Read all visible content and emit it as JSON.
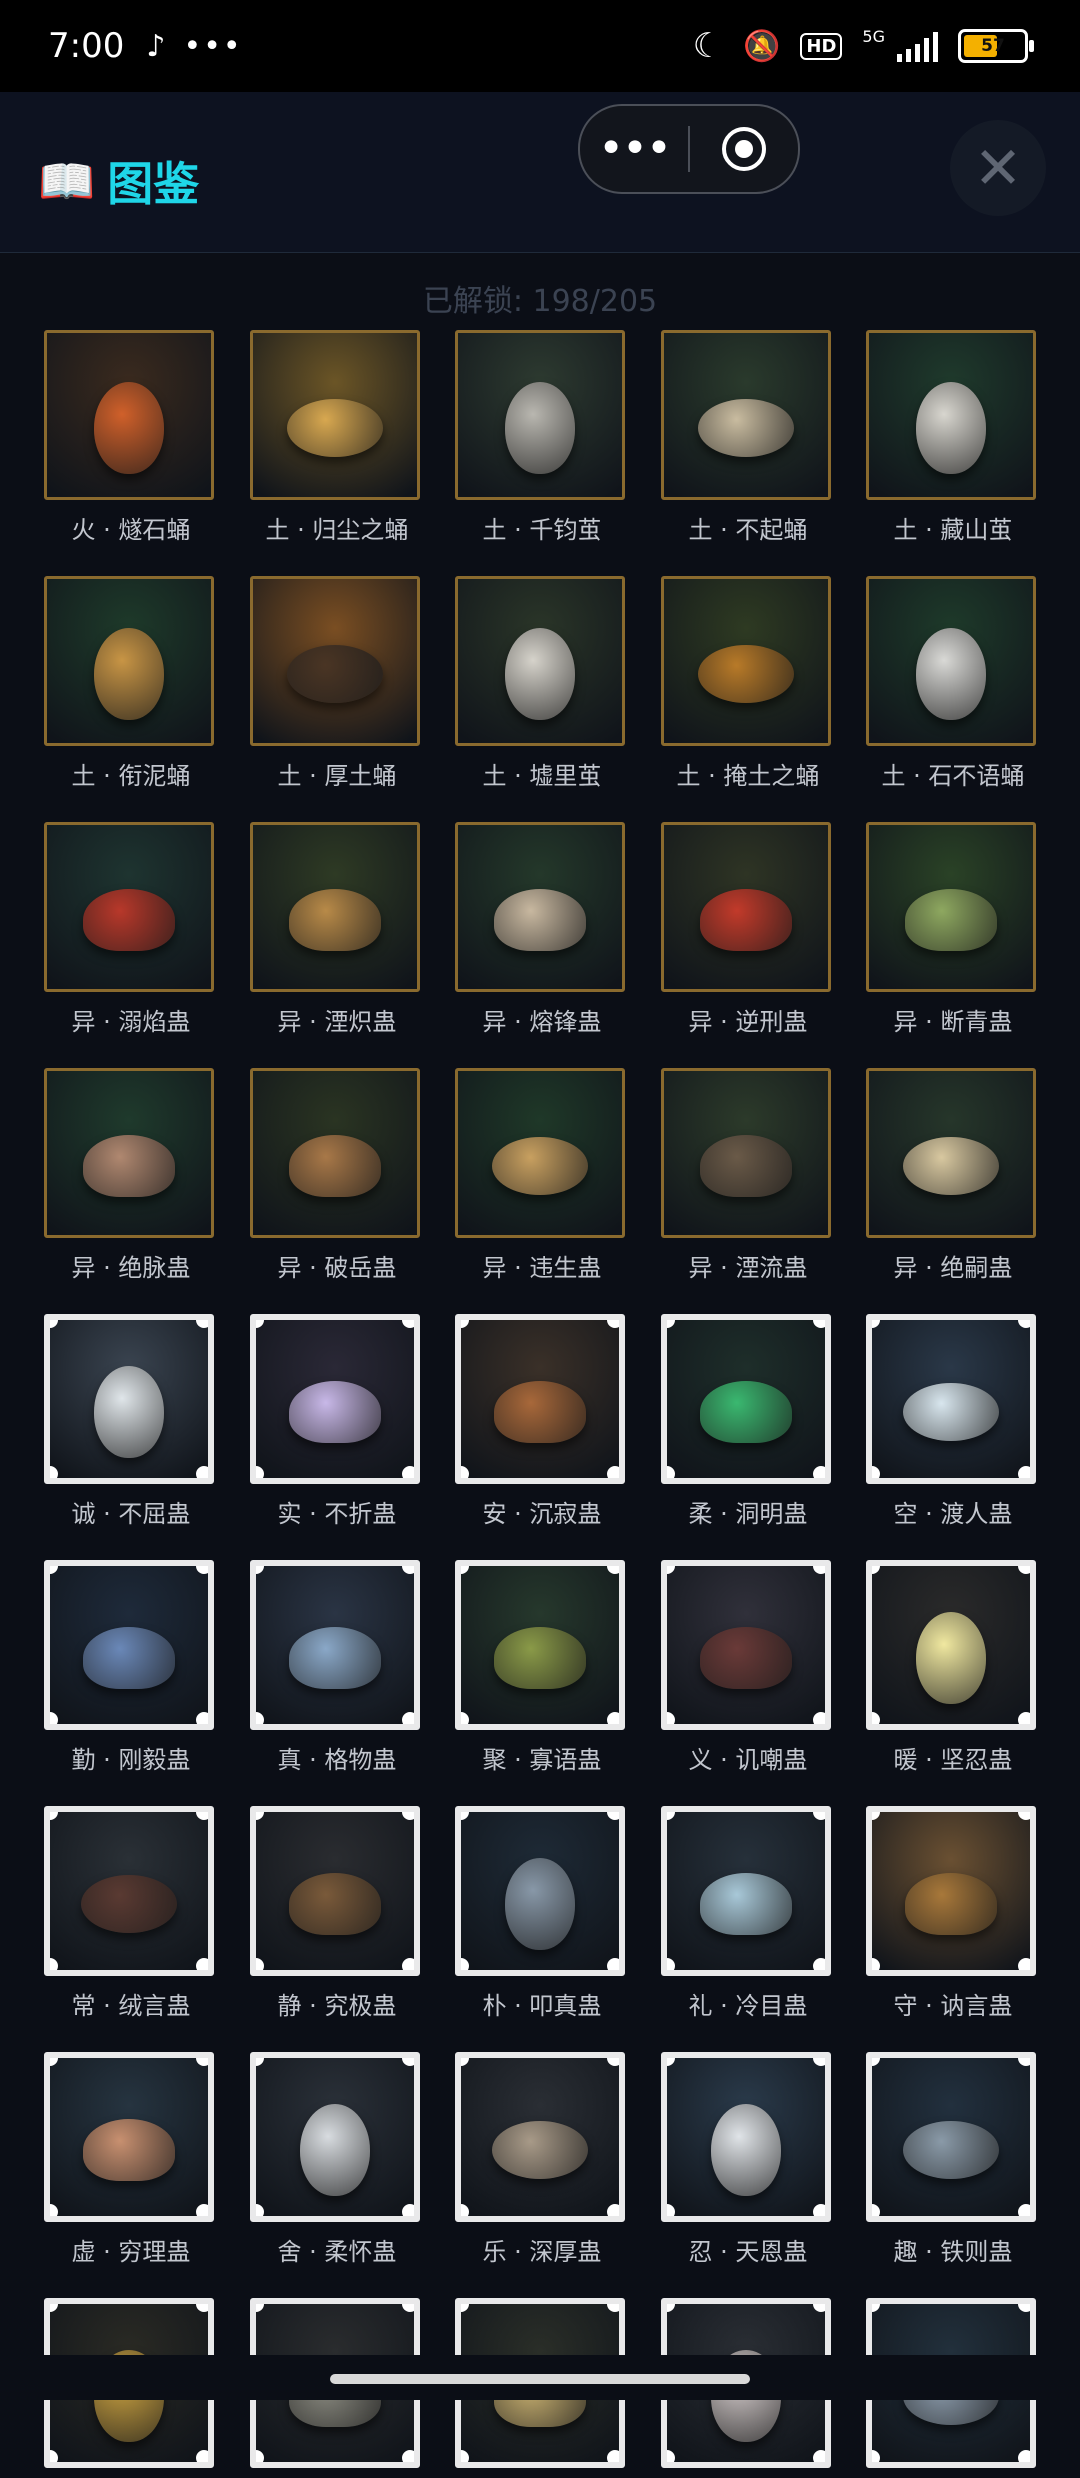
{
  "status_bar": {
    "time": "7:00",
    "network": "5G",
    "hd_badge": "HD",
    "battery": "57",
    "battery_level": 0.57,
    "icons": [
      "tiktok-icon",
      "more-dots-icon",
      "moon-icon",
      "mute-bell-icon",
      "signal-icon",
      "battery-icon"
    ]
  },
  "header": {
    "title": "图鉴",
    "book_icon": "📖",
    "capsule_more": "•••",
    "close": "✕"
  },
  "unlock_text": "已解锁: 198/205",
  "items": [
    {
      "label": "火 · 燧石蛹",
      "frame": "gold",
      "bg": "#3a2a1e",
      "c": "#d0602a",
      "s": "egg"
    },
    {
      "label": "土 · 归尘之蛹",
      "frame": "gold",
      "bg": "#6b5526",
      "c": "#d8a850",
      "s": "pupa"
    },
    {
      "label": "土 · 千钧茧",
      "frame": "gold",
      "bg": "#2d3a30",
      "c": "#b9b7b0",
      "s": "egg"
    },
    {
      "label": "土 · 不起蛹",
      "frame": "gold",
      "bg": "#2a3a2c",
      "c": "#c9bca0",
      "s": "pupa"
    },
    {
      "label": "土 · 藏山茧",
      "frame": "gold",
      "bg": "#1f3a2c",
      "c": "#d8d6cf",
      "s": "egg"
    },
    {
      "label": "土 · 衔泥蛹",
      "frame": "gold",
      "bg": "#1e3a2a",
      "c": "#c89545",
      "s": "egg"
    },
    {
      "label": "土 · 厚土蛹",
      "frame": "gold",
      "bg": "#7a4e22",
      "c": "#4a3524",
      "s": "pupa"
    },
    {
      "label": "土 · 墟里茧",
      "frame": "gold",
      "bg": "#2a3528",
      "c": "#d6d3cb",
      "s": "egg"
    },
    {
      "label": "土 · 掩土之蛹",
      "frame": "gold",
      "bg": "#2e3a22",
      "c": "#b87a28",
      "s": "pupa"
    },
    {
      "label": "土 · 石不语蛹",
      "frame": "gold",
      "bg": "#1e3a2a",
      "c": "#d9d9d6",
      "s": "egg"
    },
    {
      "label": "异 · 溺焰蛊",
      "frame": "gold",
      "bg": "#1e3430",
      "c": "#b8382a",
      "s": "bug"
    },
    {
      "label": "异 · 湮炽蛊",
      "frame": "gold",
      "bg": "#2e3a24",
      "c": "#b88a48",
      "s": "bug"
    },
    {
      "label": "异 · 熔锋蛊",
      "frame": "gold",
      "bg": "#24382a",
      "c": "#c8b8a0",
      "s": "bug"
    },
    {
      "label": "异 · 逆刑蛊",
      "frame": "gold",
      "bg": "#2e3424",
      "c": "#c23a2a",
      "s": "bug"
    },
    {
      "label": "异 · 断青蛊",
      "frame": "gold",
      "bg": "#2a4226",
      "c": "#8ea860",
      "s": "bug"
    },
    {
      "label": "异 · 绝脉蛊",
      "frame": "gold",
      "bg": "#1f3a2c",
      "c": "#b08870",
      "s": "bug"
    },
    {
      "label": "异 · 破岳蛊",
      "frame": "gold",
      "bg": "#2a3422",
      "c": "#a87848",
      "s": "bug"
    },
    {
      "label": "异 · 违生蛊",
      "frame": "gold",
      "bg": "#1f3828",
      "c": "#c8a060",
      "s": "pupa"
    },
    {
      "label": "异 · 湮流蛊",
      "frame": "gold",
      "bg": "#2c3a2a",
      "c": "#6a5a48",
      "s": "bug"
    },
    {
      "label": "异 · 绝嗣蛊",
      "frame": "gold",
      "bg": "#26362a",
      "c": "#d8c8a0",
      "s": "pupa"
    },
    {
      "label": "诚 · 不屈蛊",
      "frame": "white",
      "bg": "#3a4450",
      "c": "#e0e6ea",
      "s": "egg"
    },
    {
      "label": "实 · 不折蛊",
      "frame": "white",
      "bg": "#2a2836",
      "c": "#c8b8e8",
      "s": "bug"
    },
    {
      "label": "安 · 沉寂蛊",
      "frame": "white",
      "bg": "#3a3028",
      "c": "#a8683a",
      "s": "bug"
    },
    {
      "label": "柔 · 洞明蛊",
      "frame": "white",
      "bg": "#1e2e2a",
      "c": "#3ab870",
      "s": "bug"
    },
    {
      "label": "空 · 渡人蛊",
      "frame": "white",
      "bg": "#2a3848",
      "c": "#d8e6ee",
      "s": "pupa"
    },
    {
      "label": "勤 · 刚毅蛊",
      "frame": "white",
      "bg": "#1e2a3a",
      "c": "#6a88b8",
      "s": "bug"
    },
    {
      "label": "真 · 格物蛊",
      "frame": "white",
      "bg": "#2a3444",
      "c": "#8aa8c8",
      "s": "bug"
    },
    {
      "label": "聚 · 寡语蛊",
      "frame": "white",
      "bg": "#26382c",
      "c": "#8a9a48",
      "s": "bug"
    },
    {
      "label": "义 · 讥嘲蛊",
      "frame": "white",
      "bg": "#30303a",
      "c": "#6a3a38",
      "s": "bug"
    },
    {
      "label": "暖 · 坚忍蛊",
      "frame": "white",
      "bg": "#2a2a2a",
      "c": "#f0e8a0",
      "s": "egg"
    },
    {
      "label": "常 · 绒言蛊",
      "frame": "white",
      "bg": "#2a3036",
      "c": "#5a3a32",
      "s": "pupa"
    },
    {
      "label": "静 · 究极蛊",
      "frame": "white",
      "bg": "#2a2c30",
      "c": "#7a5a3a",
      "s": "bug"
    },
    {
      "label": "朴 · 叩真蛊",
      "frame": "white",
      "bg": "#1e2a36",
      "c": "#8898a8",
      "s": "egg"
    },
    {
      "label": "礼 · 冷目蛊",
      "frame": "white",
      "bg": "#26303a",
      "c": "#a8c8d8",
      "s": "bug"
    },
    {
      "label": "守 · 讷言蛊",
      "frame": "white",
      "bg": "#6a5032",
      "c": "#a8783a",
      "s": "bug"
    },
    {
      "label": "虚 · 穷理蛊",
      "frame": "white",
      "bg": "#263440",
      "c": "#c89070",
      "s": "bug"
    },
    {
      "label": "舍 · 柔怀蛊",
      "frame": "white",
      "bg": "#2a3038",
      "c": "#d8dce0",
      "s": "egg"
    },
    {
      "label": "乐 · 深厚蛊",
      "frame": "white",
      "bg": "#2a2e34",
      "c": "#a89a88",
      "s": "pupa"
    },
    {
      "label": "忍 · 天恩蛊",
      "frame": "white",
      "bg": "#2a3a4a",
      "c": "#e0e4e8",
      "s": "egg"
    },
    {
      "label": "趣 · 铁则蛊",
      "frame": "white",
      "bg": "#22303e",
      "c": "#8a9aa8",
      "s": "pupa"
    },
    {
      "label": "",
      "frame": "white",
      "bg": "#2a2a24",
      "c": "#c8a040",
      "s": "egg"
    },
    {
      "label": "",
      "frame": "white",
      "bg": "#2a2c2e",
      "c": "#8a8a80",
      "s": "bug"
    },
    {
      "label": "",
      "frame": "white",
      "bg": "#2a2e28",
      "c": "#c8b070",
      "s": "bug"
    },
    {
      "label": "",
      "frame": "white",
      "bg": "#2a2e34",
      "c": "#d0c8c8",
      "s": "egg"
    },
    {
      "label": "",
      "frame": "white",
      "bg": "#22303c",
      "c": "#8a9aaa",
      "s": "pupa"
    }
  ]
}
